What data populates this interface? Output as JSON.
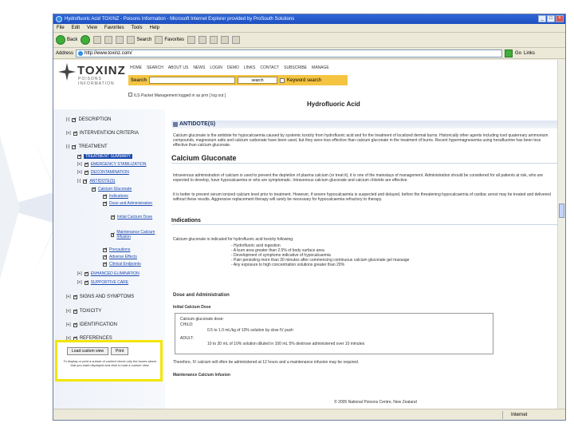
{
  "window": {
    "title": "Hydrofluoric Acid TOXINZ - Poisons Information - Microsoft Internet Explorer provided by ProSouth Solutions",
    "buttons": [
      "_",
      "□",
      "×"
    ]
  },
  "menubar": [
    "File",
    "Edit",
    "View",
    "Favorites",
    "Tools",
    "Help"
  ],
  "toolbar": {
    "back": "Back",
    "search": "Search",
    "favorites": "Favorites"
  },
  "address": {
    "label": "Address",
    "url": "http://www.toxinz.com/",
    "go": "Go",
    "links": "Links"
  },
  "site": {
    "logo": "TOXINZ",
    "logo_sub": "POISONS INFORMATION",
    "nav": [
      "HOME",
      "SEARCH",
      "ABOUT US",
      "NEWS",
      "LOGIN",
      "DEMO",
      "LINKS",
      "CONTACT",
      "SUBSCRIBE",
      "MANAGE"
    ],
    "search_label": "Search",
    "search_button": "search",
    "keyword_label": "Keyword search",
    "login_text": "ILS Packet Management logged in as prm [ log out ]"
  },
  "page_title": "Hydrofluoric Acid",
  "tree": [
    {
      "toggle": "[-]",
      "label": "DESCRIPTION"
    },
    {
      "toggle": "[+]",
      "label": "INTERVENTION CRITERIA"
    },
    {
      "toggle": "[-]",
      "label": "TREATMENT"
    },
    {
      "toggle": "",
      "label": "TREATMENT SUMMARY"
    },
    {
      "toggle": "[+]",
      "label": "EMERGENCY STABILIZATION"
    },
    {
      "toggle": "[+]",
      "label": "DECONTAMINATION"
    },
    {
      "toggle": "[-]",
      "label": "ANTIDOTE(S)"
    },
    {
      "toggle": "",
      "label": "Calcium Gluconate"
    },
    {
      "toggle": "",
      "label": "Indications"
    },
    {
      "toggle": "",
      "label": "Dose and Administration"
    },
    {
      "toggle": "",
      "label": "Initial Calcium Dose"
    },
    {
      "toggle": "",
      "label": "Maintenance Calcium Infusion"
    },
    {
      "toggle": "",
      "label": "Precautions"
    },
    {
      "toggle": "",
      "label": "Adverse Effects"
    },
    {
      "toggle": "",
      "label": "Clinical Endpoints"
    },
    {
      "toggle": "[+]",
      "label": "ENHANCED ELIMINATION"
    },
    {
      "toggle": "[+]",
      "label": "SUPPORTIVE CARE"
    },
    {
      "toggle": "[+]",
      "label": "SIGNS AND SYMPTOMS"
    },
    {
      "toggle": "[+]",
      "label": "TOXICITY"
    },
    {
      "toggle": "[+]",
      "label": "IDENTIFICATION"
    },
    {
      "toggle": "[+]",
      "label": "REFERENCES"
    }
  ],
  "custom_view": {
    "load": "Load custom view",
    "print": "Print",
    "help": "To display or print a subset of content check only the boxes above that you want displayed and click to load a custom view."
  },
  "main": {
    "section": "ANTIDOTE(S)",
    "intro": "Calcium gluconate is the antidote for hypocalcaemia caused by systemic toxicity from hydrofluoric acid and for the treatment of localized dermal burns. Historically other agents including iced quaternary ammonium compounds, magnesium salts and calcium carbonate have been used, but they were less effective than calcium gluconate in the treatment of burns. Recent hypermagnesemia using hexafluorine has been less effective than calcium gluconate.",
    "cg_title": "Calcium Gluconate",
    "cg_p1": "Intravenous administration of calcium is used to prevent the depletion of plasma calcium (or treat it), it is one of the mainstays of management. Administration should be considered for all patients at risk, who are expected to develop, have hypocalcaemia or who are symptomatic. Intravenous calcium gluconate and calcium chloride are effective.",
    "cg_p2": "It is better to prevent serum ionized calcium level prior to treatment. However, if severe hypocalcaemia is suspected and delayed, before the threatening hypocalcaemia of cardiac arrest may be treated and delivered without these results. Aggressive replacement therapy will rarely be necessary for hypocalcaemia refractory to therapy.",
    "ind_title": "Indications",
    "ind_p": "Calcium gluconate is indicated for hydrofluoric acid toxicity following:",
    "ind_items": [
      "- Hydrofluoric acid ingestion",
      "- A burn area greater than 2.5% of body surface area",
      "- Development of symptoms indicative of hypocalcaemia",
      "- Pain persisting more than 30 minutes after commencing continuous calcium gluconate gel massage",
      "- Any exposure to high concentration solutions greater than 20%"
    ],
    "dose_title": "Dose and Administration",
    "initial_title": "Initial Calcium Dose",
    "dose_box": {
      "label": "Calcium gluconate dose:",
      "child": "CHILD:",
      "child_text": "0.5 to 1.0 mL/kg of 10% solution by slow IV push",
      "adult": "ADULT:",
      "adult_text": "10 to 30 mL of 10% solution diluted in 100 mL 5% dextrose administered over 10 minutes"
    },
    "followup": "Therefore, IV calcium will often be administered at 12 hours and a maintenance infusion may be required.",
    "maint_title": "Maintenance Calcium Infusion"
  },
  "copyright": "© 2005 National Poisons Centre, New Zealand",
  "status": {
    "zone": "Internet"
  }
}
